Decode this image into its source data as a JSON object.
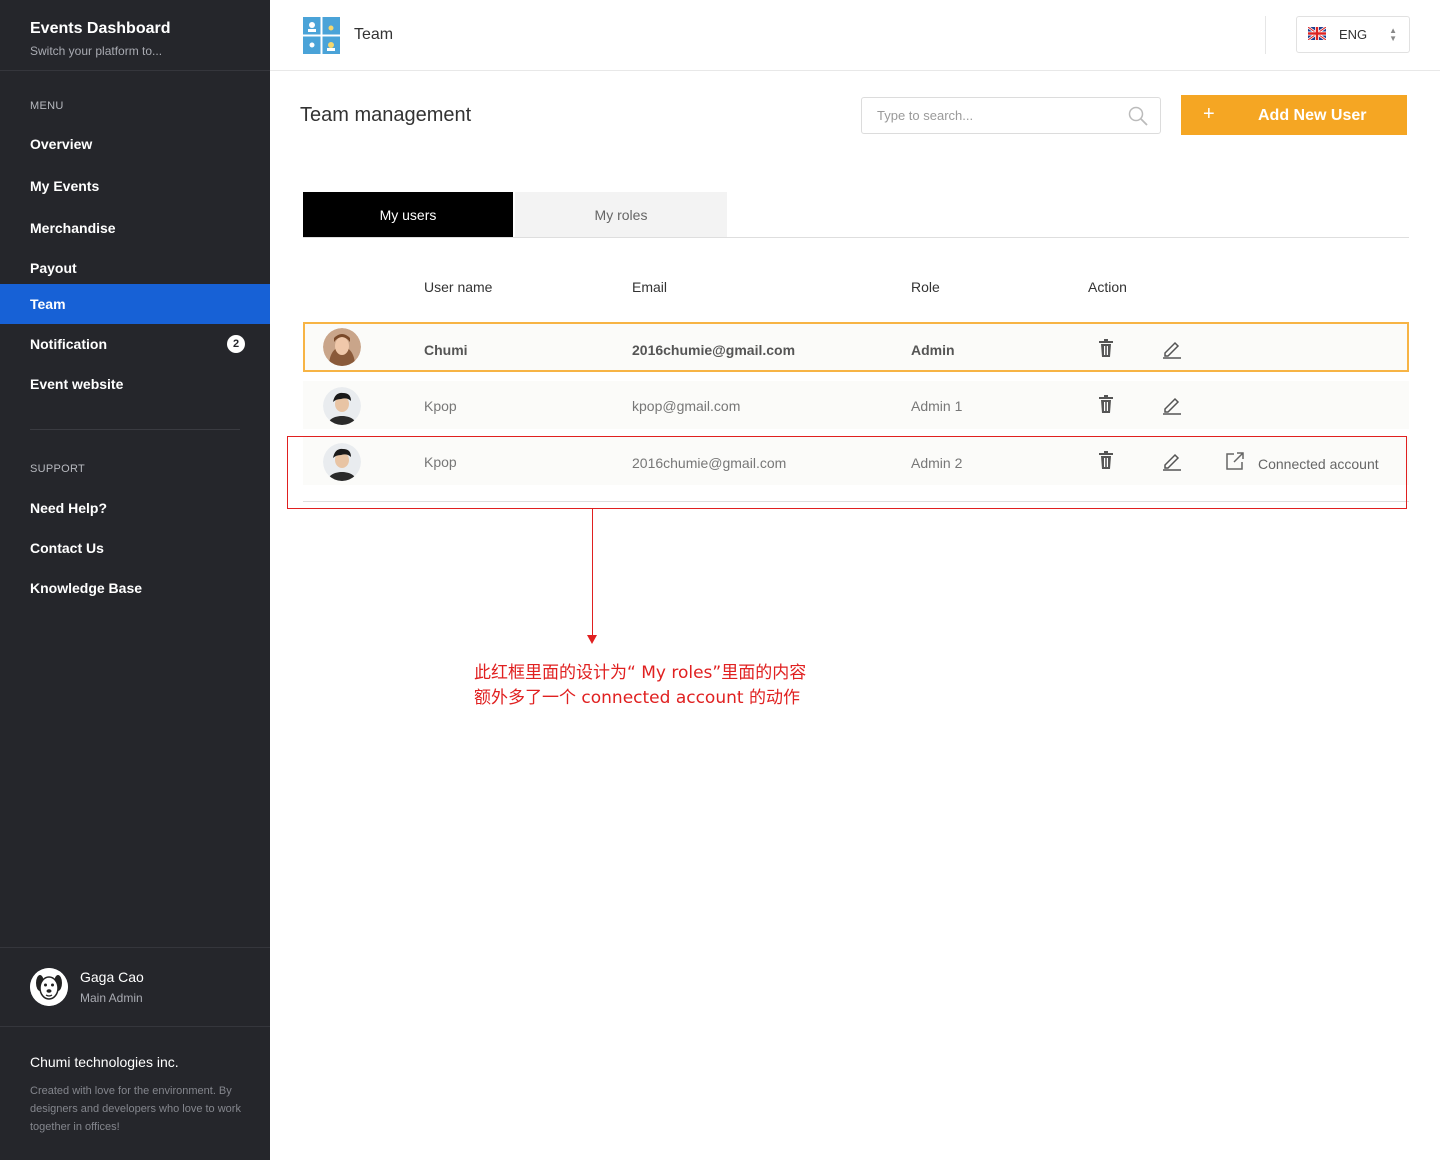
{
  "sidebar": {
    "title": "Events Dashboard",
    "subtitle": "Switch your platform to...",
    "menu_heading": "MENU",
    "menu": [
      {
        "label": "Overview"
      },
      {
        "label": "My Events"
      },
      {
        "label": "Merchandise"
      },
      {
        "label": "Payout"
      },
      {
        "label": "Team",
        "active": true
      },
      {
        "label": "Notification",
        "badge": "2"
      },
      {
        "label": "Event website"
      }
    ],
    "support_heading": "SUPPORT",
    "support": [
      {
        "label": "Need Help?"
      },
      {
        "label": "Contact Us"
      },
      {
        "label": "Knowledge Base"
      }
    ],
    "profile": {
      "name": "Gaga Cao",
      "role": "Main Admin",
      "avatar_icon": "dog-avatar-icon"
    },
    "company": {
      "name": "Chumi technologies inc.",
      "description": "Created with love for the environment. By designers and developers who love to work together in offices!"
    }
  },
  "header": {
    "title": "Team",
    "logo_icon": "team-logo-icon",
    "language": {
      "label": "ENG",
      "flag_icon": "uk-flag-icon"
    }
  },
  "main": {
    "page_title": "Team management",
    "search": {
      "placeholder": "Type to search..."
    },
    "add_button": {
      "plus": "+",
      "label": "Add New User"
    },
    "tabs": [
      {
        "label": "My users",
        "active": true
      },
      {
        "label": "My roles",
        "active": false
      }
    ],
    "table": {
      "headers": {
        "username": "User name",
        "email": "Email",
        "role": "Role",
        "action": "Action"
      },
      "rows": [
        {
          "username": "Chumi",
          "email": "2016chumie@gmail.com",
          "role": "Admin",
          "selected": true
        },
        {
          "username": "Kpop",
          "email": "kpop@gmail.com",
          "role": "Admin 1"
        },
        {
          "username": "Kpop",
          "email": "2016chumie@gmail.com",
          "role": "Admin 2",
          "extra_action": "Connected account"
        }
      ]
    }
  },
  "annotation": {
    "line1": "此红框里面的设计为“ My roles”里面的内容",
    "line2": "额外多了一个 connected account 的动作"
  },
  "colors": {
    "sidebar_bg": "#25262b",
    "active_item": "#1761d6",
    "accent": "#f5a623",
    "annotation": "#e02020"
  }
}
